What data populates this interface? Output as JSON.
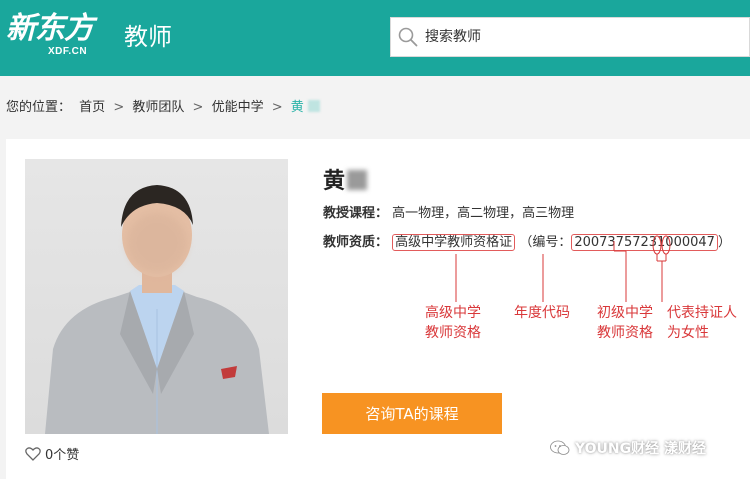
{
  "header": {
    "logo_text": "新东方",
    "logo_sub": "XDF.CN",
    "title": "教师",
    "search_placeholder": "搜索教师",
    "brand_color": "#1aa79c"
  },
  "breadcrumb": {
    "prefix": "您的位置：",
    "items": [
      "首页",
      "教师团队",
      "优能中学",
      "黄"
    ],
    "separator": ">"
  },
  "teacher": {
    "name": "黄",
    "courses_label": "教授课程：",
    "courses": "高一物理，高二物理，高三物理",
    "qualification_label": "教师资质：",
    "qualification": "高级中学教师资格证",
    "number_prefix": "（编号：",
    "number": "20073757231000047",
    "number_suffix": "）",
    "likes": "0个赞"
  },
  "annotations": {
    "senior": [
      "高级中学",
      "教师资格"
    ],
    "year": "年度代码",
    "junior": [
      "初级中学",
      "教师资格"
    ],
    "female": [
      "代表持证人",
      "为女性"
    ],
    "color": "#d9383a"
  },
  "cta": {
    "label": "咨询TA的课程",
    "color": "#f79322"
  },
  "watermark": "YOUNG财经 漾财经"
}
